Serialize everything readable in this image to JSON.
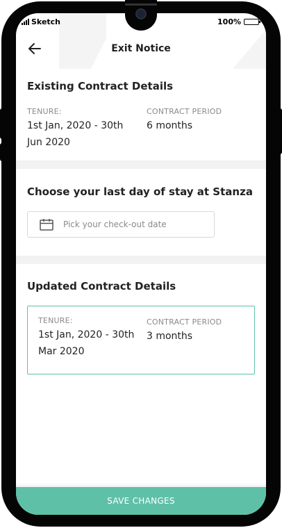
{
  "status_bar": {
    "carrier": "Sketch",
    "battery_percent": "100%",
    "battery_level": 1.0
  },
  "header": {
    "title": "Exit Notice",
    "back_icon": "arrow-left-icon"
  },
  "existing_contract": {
    "heading": "Existing Contract Details",
    "tenure_label": "TENURE:",
    "tenure_line1": "1st Jan, 2020 - 30th",
    "tenure_line2": "Jun 2020",
    "period_label": "CONTRACT PERIOD",
    "period_value": "6 months"
  },
  "checkout": {
    "heading": "Choose your last day of stay at Stanza",
    "placeholder": "Pick your check-out date",
    "icon": "calendar-icon"
  },
  "updated_contract": {
    "heading": "Updated Contract Details",
    "tenure_label": "TENURE:",
    "tenure_line1": "1st Jan, 2020 - 30th",
    "tenure_line2": "Mar 2020",
    "period_label": "CONTRACT PERIOD",
    "period_value": "3 months"
  },
  "footer": {
    "save_label": "SAVE CHANGES"
  },
  "colors": {
    "accent": "#5fc0a8",
    "phone_frame": "#050505",
    "separator": "#f2f2f2"
  }
}
